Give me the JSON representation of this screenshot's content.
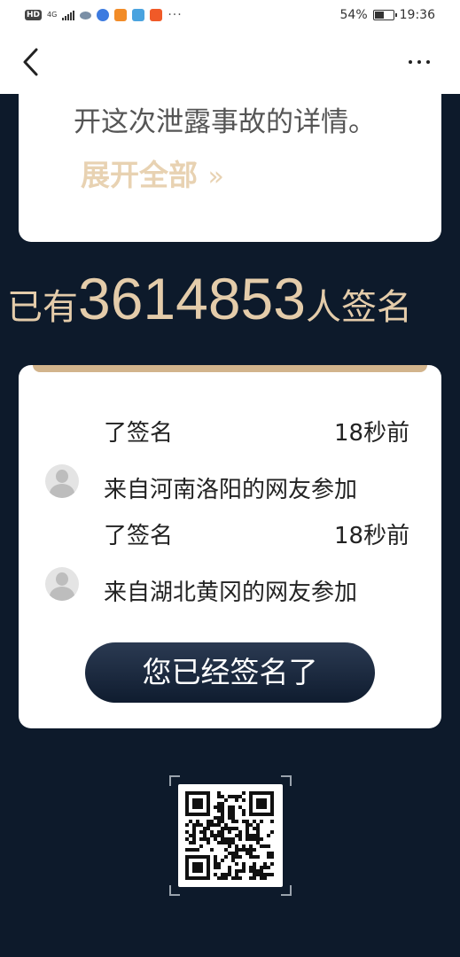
{
  "status_bar": {
    "hd": "HD",
    "network": "4G",
    "dots": "···",
    "battery_percent": "54%",
    "battery_level": 0.54,
    "time": "19:36",
    "app_icon_colors": [
      "#7a8fa6",
      "#3d7be0",
      "#f28c28",
      "#4aa3df",
      "#f05a28"
    ]
  },
  "nav": {
    "back_icon": "chevron-left-icon",
    "more_icon": "more-dots-icon"
  },
  "article": {
    "detail_text": "开这次泄露事故的详情。",
    "expand_label": "展开全部",
    "expand_chevron": "»"
  },
  "counter": {
    "prefix": "已有",
    "count": "3614853",
    "suffix": "人签名"
  },
  "feed": {
    "row1_tail": "了签名",
    "row1_time": "18秒前",
    "row2_text": "来自河南洛阳的网友参加",
    "row2_tail": "了签名",
    "row2_time": "18秒前",
    "row3_text": "来自湖北黄冈的网友参加"
  },
  "signed_button": "您已经签名了",
  "colors": {
    "background": "#0d1a2b",
    "accent_gold": "#e4ccaa"
  }
}
